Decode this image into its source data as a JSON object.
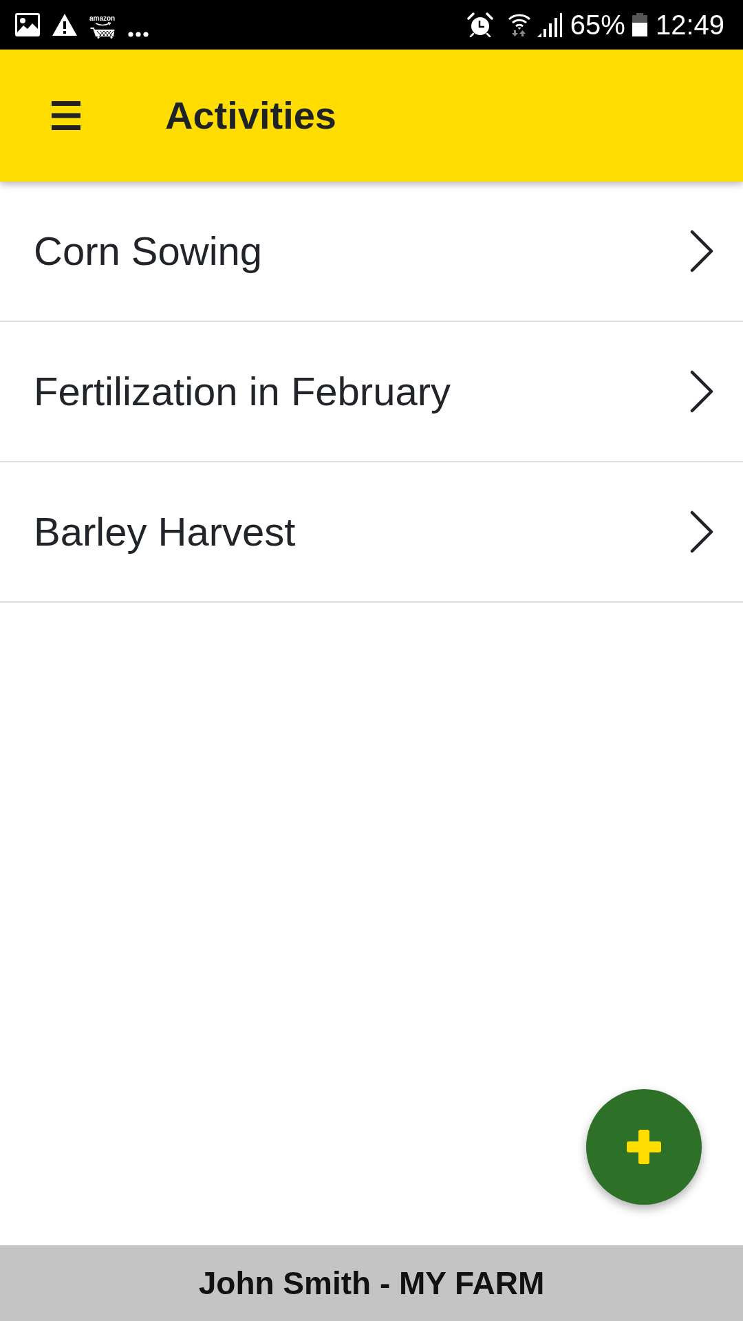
{
  "status_bar": {
    "notification_logo_text": "amazon",
    "battery_percent": "65%",
    "time": "12:49"
  },
  "app_bar": {
    "title": "Activities"
  },
  "activities": [
    {
      "title": "Corn Sowing"
    },
    {
      "title": "Fertilization in February"
    },
    {
      "title": "Barley Harvest"
    }
  ],
  "footer": {
    "text": "John Smith - MY FARM"
  }
}
